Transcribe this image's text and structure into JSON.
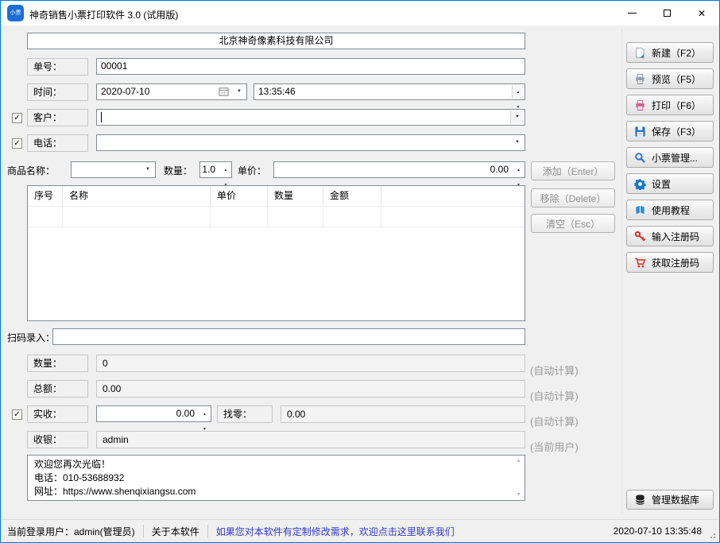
{
  "window": {
    "title": "神奇销售小票打印软件 3.0 (试用版)"
  },
  "glyphs": {
    "checkmark": "✓",
    "dropdown": "▼",
    "spin_up": "▲",
    "spin_down": "▼",
    "scroll_up": "▲",
    "scroll_down": "▼",
    "close": "✕"
  },
  "company": {
    "value": "北京神奇像素科技有限公司"
  },
  "fields": {
    "order": {
      "label": "单号：",
      "value": "00001"
    },
    "time": {
      "label": "时间：",
      "date": "2020-07-10",
      "time": "13:35:46"
    },
    "customer": {
      "label": "客户：",
      "value": ""
    },
    "phone": {
      "label": "电话：",
      "value": ""
    },
    "product": {
      "label": "商品名称：",
      "value": ""
    },
    "qty": {
      "label": "数量：",
      "value": "1.0"
    },
    "price": {
      "label": "单价：",
      "value": "0.00"
    }
  },
  "actions": {
    "add": "添加（Enter）",
    "remove": "移除（Delete）",
    "clear": "清空（Esc）"
  },
  "table": {
    "headers": [
      "序号",
      "名称",
      "单价",
      "数量",
      "金额"
    ]
  },
  "scan": {
    "label": "扫码录入：",
    "value": ""
  },
  "totals": {
    "qty": {
      "label": "数量：",
      "value": "0",
      "note": "(自动计算)"
    },
    "total": {
      "label": "总额：",
      "value": "0.00",
      "note": "(自动计算)"
    },
    "received": {
      "label": "实收：",
      "value": "0.00",
      "note": "(自动计算)"
    },
    "change": {
      "label": "找零：",
      "value": "0.00"
    },
    "cashier": {
      "label": "收银：",
      "value": "admin",
      "note": "(当前用户)"
    }
  },
  "welcome": {
    "lines": [
      "欢迎您再次光临！",
      "电话：010-53688932",
      "网址：https://www.shenqixiangsu.com"
    ]
  },
  "sidebar": {
    "buttons": [
      {
        "label": "新建（F2）",
        "icon": "new-document-icon"
      },
      {
        "label": "预览（F5）",
        "icon": "print-preview-icon"
      },
      {
        "label": "打印（F6）",
        "icon": "printer-icon"
      },
      {
        "label": "保存（F3）",
        "icon": "save-icon"
      },
      {
        "label": "小票管理...",
        "icon": "search-icon"
      },
      {
        "label": "设置",
        "icon": "gear-icon"
      },
      {
        "label": "使用教程",
        "icon": "book-icon"
      },
      {
        "label": "输入注册码",
        "icon": "key-icon"
      },
      {
        "label": "获取注册码",
        "icon": "cart-icon"
      }
    ],
    "manage_db": {
      "label": "管理数据库",
      "icon": "database-icon"
    }
  },
  "statusbar": {
    "user": "当前登录用户：admin(管理员)",
    "about": "关于本软件",
    "link": "如果您对本软件有定制修改需求，欢迎点击这里联系我们",
    "datetime": "2020-07-10 13:35:48"
  },
  "colors": {
    "window_border": "#0079d8",
    "link": "#3139d1",
    "note_gray": "#9a9a9a",
    "titlebar_bg": "#ffffff"
  }
}
